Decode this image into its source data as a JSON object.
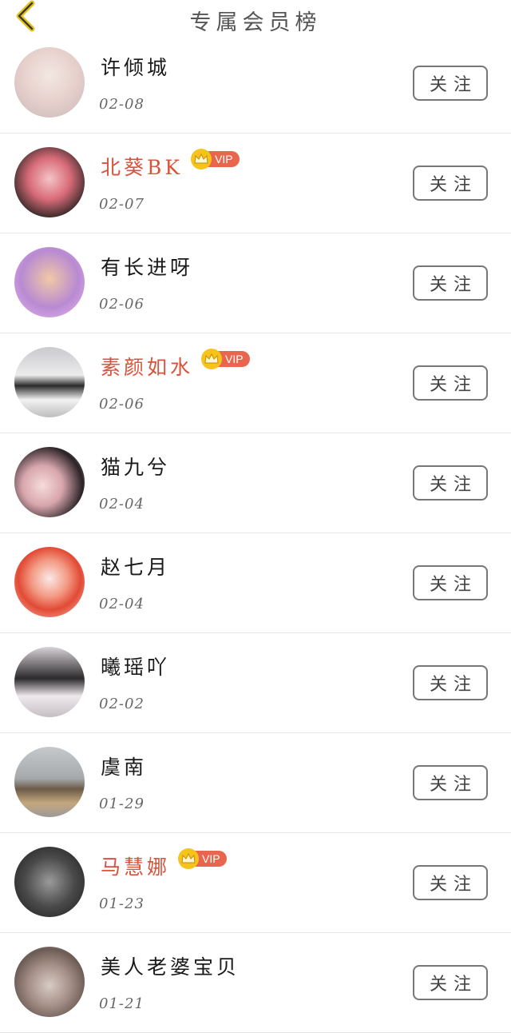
{
  "header": {
    "title": "专属会员榜",
    "back_icon": "chevron-left-icon",
    "accent_color": "#e8c41c"
  },
  "colors": {
    "vip_name": "#d9533b",
    "vip_badge": "#e8664d",
    "crown": "#f6c21c"
  },
  "members": [
    {
      "name": "许倾城",
      "date": "02-08",
      "vip": false,
      "follow_label": "关注"
    },
    {
      "name": "北葵BK",
      "date": "02-07",
      "vip": true,
      "vip_label": "VIP",
      "follow_label": "关注"
    },
    {
      "name": "有长进呀",
      "date": "02-06",
      "vip": false,
      "follow_label": "关注"
    },
    {
      "name": "素颜如水",
      "date": "02-06",
      "vip": true,
      "vip_label": "VIP",
      "follow_label": "关注"
    },
    {
      "name": "猫九兮",
      "date": "02-04",
      "vip": false,
      "follow_label": "关注"
    },
    {
      "name": "赵七月",
      "date": "02-04",
      "vip": false,
      "follow_label": "关注"
    },
    {
      "name": "曦瑶吖",
      "date": "02-02",
      "vip": false,
      "follow_label": "关注"
    },
    {
      "name": "虞南",
      "date": "01-29",
      "vip": false,
      "follow_label": "关注"
    },
    {
      "name": "马慧娜",
      "date": "01-23",
      "vip": true,
      "vip_label": "VIP",
      "follow_label": "关注"
    },
    {
      "name": "美人老婆宝贝",
      "date": "01-21",
      "vip": false,
      "follow_label": "关注"
    }
  ]
}
